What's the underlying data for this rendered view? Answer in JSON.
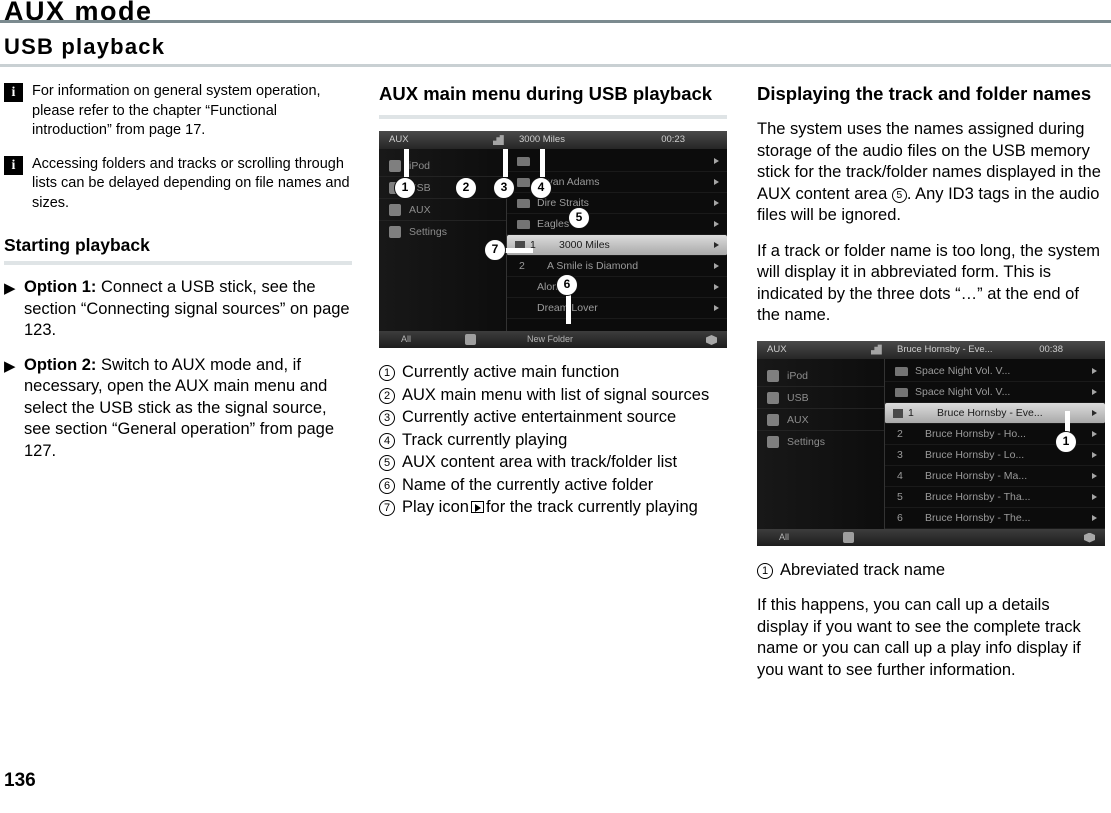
{
  "document": {
    "title": "AUX mode",
    "section": "USB playback",
    "page_number": "136"
  },
  "left_column": {
    "notes": [
      {
        "icon": "info-icon",
        "text": "For information on general system operation, please refer to the chapter “Functional introduction” from page 17."
      },
      {
        "icon": "info-icon",
        "text": "Accessing folders and tracks or scrolling through lists can be delayed depending on file names and sizes."
      }
    ],
    "subheading": "Starting playback",
    "bullets": [
      {
        "marker": "▶",
        "bold": "Option 1:",
        "text": " Connect a USB stick, see the section “Connecting signal sources” on page 123."
      },
      {
        "marker": "▶",
        "bold": "Option 2:",
        "text": " Switch to AUX mode and, if necessary, open the AUX main menu and select the USB stick as the signal source, see section “General operation” from page 127."
      }
    ]
  },
  "middle_column": {
    "heading": "AUX main menu during USB playback",
    "screenshot": {
      "status_bar": {
        "source": "AUX",
        "now_playing": "3000 Miles",
        "time": "00:23"
      },
      "sidebar_items": [
        "iPod",
        "USB",
        "AUX",
        "Settings"
      ],
      "list_rows": [
        {
          "kind": "folder",
          "label": ""
        },
        {
          "kind": "folder",
          "label": "Bryan Adams"
        },
        {
          "kind": "folder",
          "label": "Dire Straits"
        },
        {
          "kind": "folder",
          "label": "Eagles"
        },
        {
          "kind": "track",
          "num": "1",
          "label": "3000 Miles",
          "selected": true
        },
        {
          "kind": "track",
          "num": "2",
          "label": "A Smile is Diamond"
        },
        {
          "kind": "track",
          "num": "",
          "label": "Alone"
        },
        {
          "kind": "track",
          "num": "",
          "label": "Dream Lover"
        }
      ],
      "footer": {
        "left": "All",
        "folder_label": "New Folder"
      },
      "callouts": [
        "1",
        "2",
        "3",
        "4",
        "5",
        "6",
        "7"
      ]
    },
    "legend": [
      {
        "num": "1",
        "text": "Currently active main function"
      },
      {
        "num": "2",
        "text": "AUX main menu with list of signal sources"
      },
      {
        "num": "3",
        "text": "Currently active entertainment source"
      },
      {
        "num": "4",
        "text": "Track currently playing"
      },
      {
        "num": "5",
        "text": "AUX content area with track/folder list"
      },
      {
        "num": "6",
        "text": "Name of the currently active folder"
      },
      {
        "num": "7_part1",
        "text": "Play icon"
      },
      {
        "num": "7_part2",
        "text": "for the track currently playing"
      }
    ]
  },
  "right_column": {
    "heading": "Displaying the track and folder names",
    "paragraph_1_a": "The system uses the names assigned during storage of the audio files on the USB memory stick for the track/folder names displayed in the AUX content area ",
    "paragraph_1_ref": "5",
    "paragraph_1_b": ". Any ID3 tags in the audio files will be ignored.",
    "paragraph_2": "If a track or folder name is too long, the system will display it in abbreviated form. This is indicated by the three dots “…” at the end of the name.",
    "screenshot": {
      "status_bar": {
        "source": "AUX",
        "now_playing": "Bruce Hornsby - Eve...",
        "time": "00:38"
      },
      "sidebar_items": [
        "iPod",
        "USB",
        "AUX",
        "Settings"
      ],
      "list_rows": [
        {
          "kind": "folder",
          "label": "Space Night Vol. V..."
        },
        {
          "kind": "folder",
          "label": "Space Night Vol. V..."
        },
        {
          "kind": "track",
          "num": "1",
          "label": "Bruce Hornsby - Eve...",
          "selected": true
        },
        {
          "kind": "track",
          "num": "2",
          "label": "Bruce Hornsby - Ho..."
        },
        {
          "kind": "track",
          "num": "3",
          "label": "Bruce Hornsby - Lo..."
        },
        {
          "kind": "track",
          "num": "4",
          "label": "Bruce Hornsby - Ma..."
        },
        {
          "kind": "track",
          "num": "5",
          "label": "Bruce Hornsby - Tha..."
        },
        {
          "kind": "track",
          "num": "6",
          "label": "Bruce Hornsby - The..."
        }
      ],
      "footer": {
        "left": "All",
        "folder_label": ""
      },
      "callouts": [
        "1"
      ]
    },
    "legend": [
      {
        "num": "1",
        "text": "Abreviated track name"
      }
    ],
    "paragraph_3": "If this happens, you can call up a details display if you want to see the complete track name or you can call up a play info display if you want to see further information."
  },
  "colors": {
    "title_rule": "#7b8a8f",
    "section_rule": "#c9d0d3",
    "subhead_rule": "#dfe4e6",
    "screen_bg": "#0a0a0a",
    "selected_row": "#c8c8c8"
  }
}
